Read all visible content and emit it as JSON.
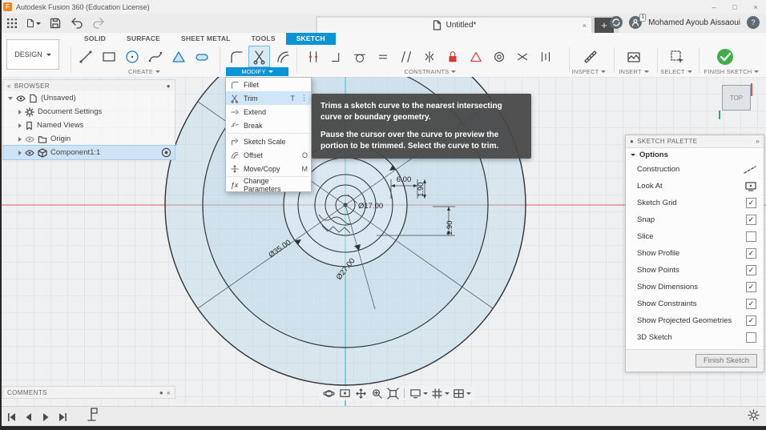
{
  "ui": {
    "logo": "F",
    "caret": "▾",
    "check": "✓",
    "close": "×",
    "minus": "–",
    "maximize": "□",
    "plus": "+",
    "menu_dots": "⋮",
    "fx": "ƒx",
    "help": "?",
    "chevL": "«",
    "chevR": "»",
    "dot": "●"
  },
  "titlebar": {
    "app_title": "Autodesk Fusion 360 (Education License)"
  },
  "topbar": {
    "doc_tab": "Untitled*",
    "user_name": "Mohamed Ayoub Aissaoui",
    "badge": "1"
  },
  "ribbon": {
    "design": "DESIGN",
    "tabs": [
      {
        "label": "SOLID"
      },
      {
        "label": "SURFACE"
      },
      {
        "label": "SHEET METAL"
      },
      {
        "label": "TOOLS"
      },
      {
        "label": "SKETCH",
        "active": true
      }
    ],
    "sections": {
      "create": "CREATE",
      "modify": "MODIFY",
      "constraints": "CONSTRAINTS",
      "inspect": "INSPECT",
      "insert": "INSERT",
      "select": "SELECT",
      "finish": "FINISH SKETCH"
    }
  },
  "modify_menu": {
    "items": [
      {
        "label": "Fillet",
        "shortcut": ""
      },
      {
        "label": "Trim",
        "shortcut": "T",
        "highlighted": true
      },
      {
        "label": "Extend",
        "shortcut": ""
      },
      {
        "label": "Break",
        "shortcut": ""
      },
      {
        "label": "Sketch Scale",
        "shortcut": ""
      },
      {
        "label": "Offset",
        "shortcut": "O"
      },
      {
        "label": "Move/Copy",
        "shortcut": "M"
      },
      {
        "label": "Change Parameters",
        "shortcut": ""
      }
    ]
  },
  "tooltip": {
    "title": "Trims a sketch curve to the nearest intersecting curve or boundary geometry.",
    "body": "Pause the cursor over the curve to preview the portion to be trimmed. Select the curve to trim."
  },
  "browser": {
    "header": "BROWSER",
    "items": [
      {
        "label": "(Unsaved)"
      },
      {
        "label": "Document Settings"
      },
      {
        "label": "Named Views"
      },
      {
        "label": "Origin"
      },
      {
        "label": "Component1:1",
        "selected": true
      }
    ]
  },
  "sketch_palette": {
    "header": "SKETCH PALETTE",
    "section": "Options",
    "rows": [
      {
        "label": "Construction",
        "control": "icon"
      },
      {
        "label": "Look At",
        "control": "icon"
      },
      {
        "label": "Sketch Grid",
        "control": "checkbox",
        "checked": true
      },
      {
        "label": "Snap",
        "control": "checkbox",
        "checked": true
      },
      {
        "label": "Slice",
        "control": "checkbox",
        "checked": false
      },
      {
        "label": "Show Profile",
        "control": "checkbox",
        "checked": true
      },
      {
        "label": "Show Points",
        "control": "checkbox",
        "checked": true
      },
      {
        "label": "Show Dimensions",
        "control": "checkbox",
        "checked": true
      },
      {
        "label": "Show Constraints",
        "control": "checkbox",
        "checked": true
      },
      {
        "label": "Show Projected Geometries",
        "control": "checkbox",
        "checked": true
      },
      {
        "label": "3D Sketch",
        "control": "checkbox",
        "checked": false
      }
    ],
    "finish_button": "Finish Sketch"
  },
  "canvas": {
    "viewcube": "TOP",
    "dimensions": {
      "d6": "6.00",
      "v190a": "1.90",
      "dia17": "Ø17.00",
      "v190b": "1.90",
      "dia35": "Ø35.00",
      "dia27": "Ø27.00"
    }
  },
  "comments": {
    "header": "COMMENTS"
  }
}
